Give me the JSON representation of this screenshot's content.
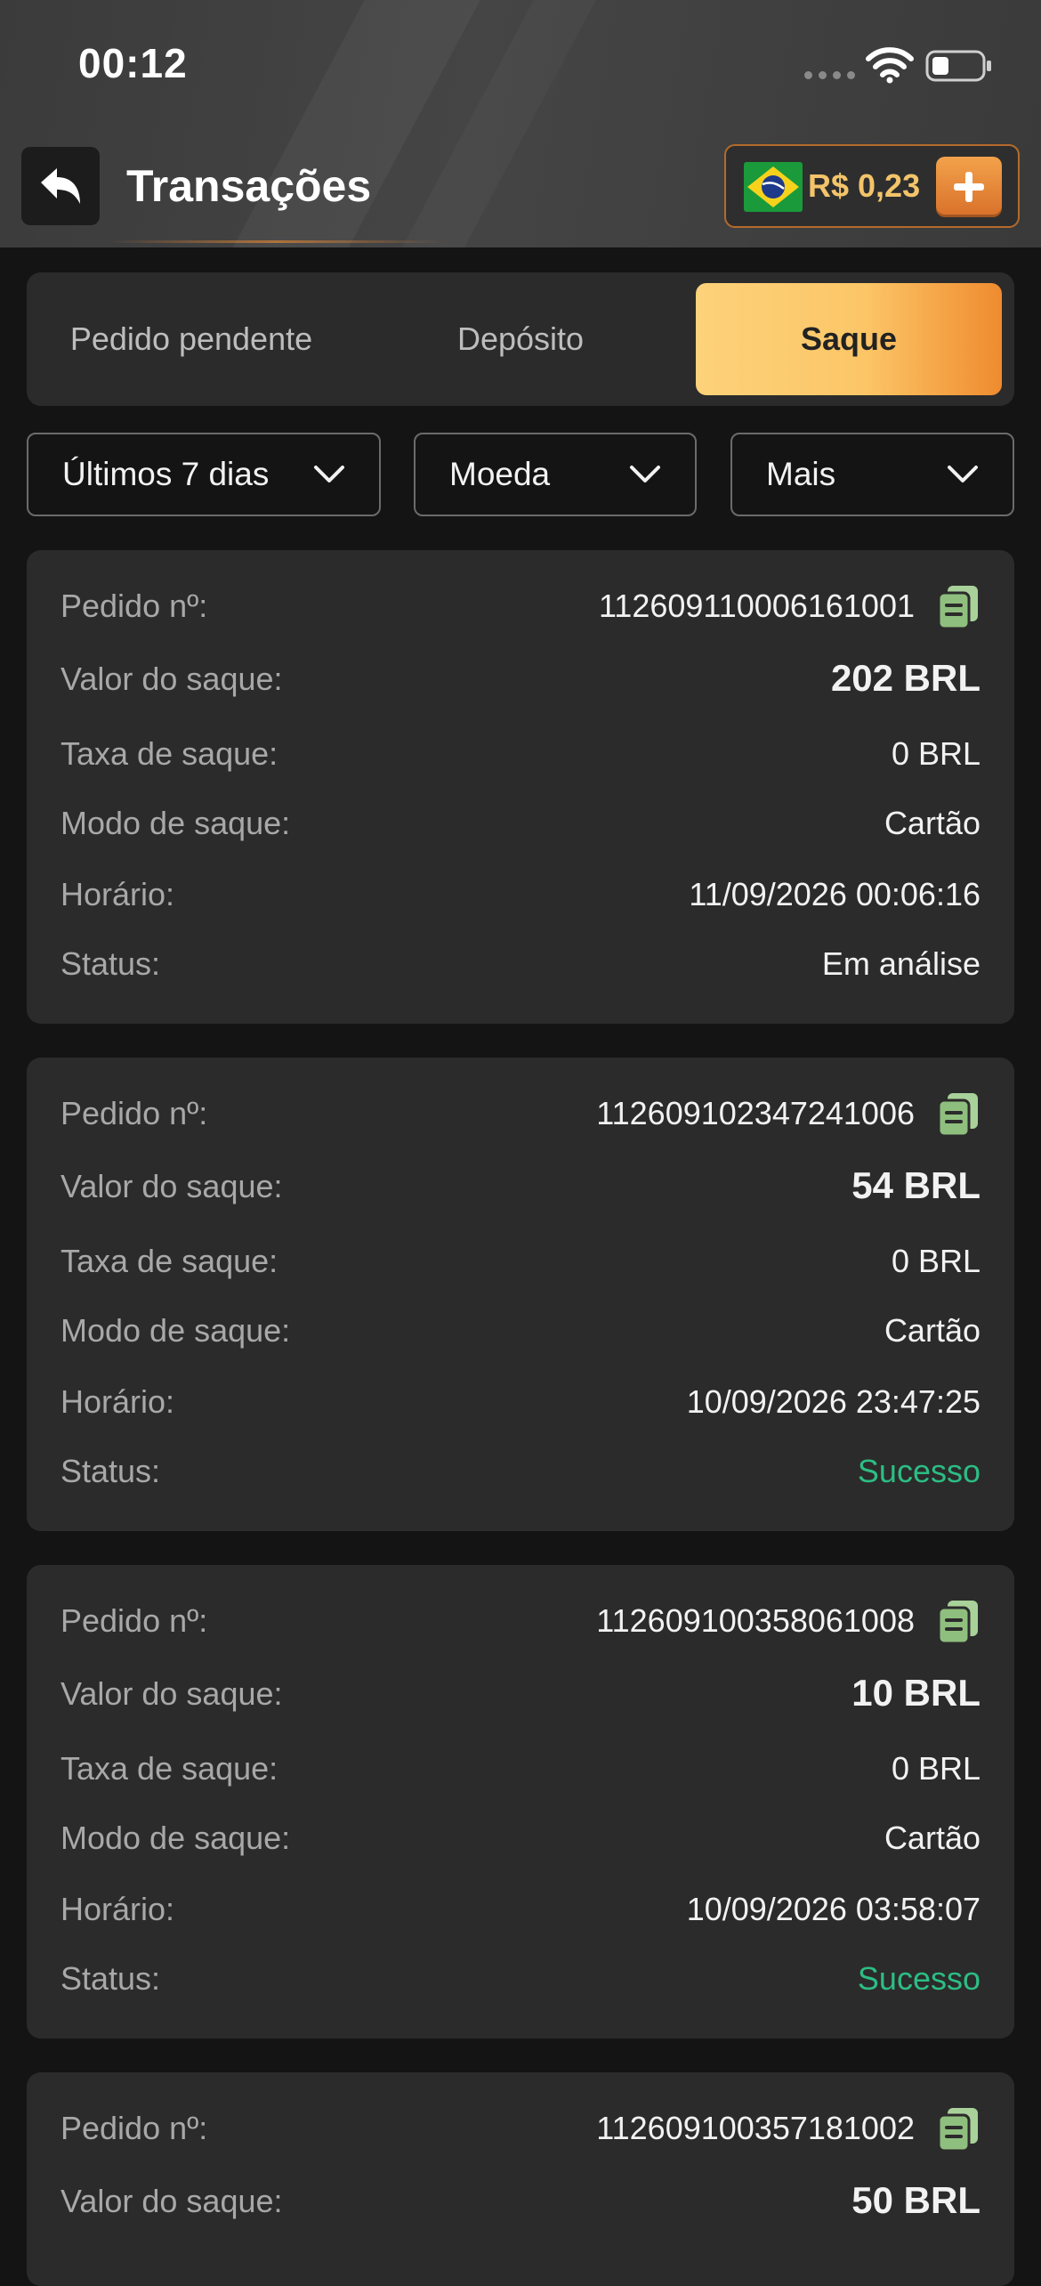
{
  "status_bar": {
    "time": "00:12"
  },
  "header": {
    "title": "Transações",
    "balance": "R$ 0,23"
  },
  "tabs": [
    {
      "label": "Pedido pendente",
      "active": false
    },
    {
      "label": "Depósito",
      "active": false
    },
    {
      "label": "Saque",
      "active": true
    }
  ],
  "filters": [
    {
      "label": "Últimos 7 dias"
    },
    {
      "label": "Moeda"
    },
    {
      "label": "Mais"
    }
  ],
  "labels": {
    "order": "Pedido nº:",
    "amount": "Valor do saque:",
    "fee": "Taxa de saque:",
    "mode": "Modo de saque:",
    "time": "Horário:",
    "status": "Status:"
  },
  "transactions": [
    {
      "order": "112609110006161001",
      "amount": "202 BRL",
      "fee": "0 BRL",
      "mode": "Cartão",
      "time": "11/09/2026 00:06:16",
      "status": "Em análise"
    },
    {
      "order": "112609102347241006",
      "amount": "54 BRL",
      "fee": "0 BRL",
      "mode": "Cartão",
      "time": "10/09/2026 23:47:25",
      "status": "Sucesso"
    },
    {
      "order": "112609100358061008",
      "amount": "10 BRL",
      "fee": "0 BRL",
      "mode": "Cartão",
      "time": "10/09/2026 03:58:07",
      "status": "Sucesso"
    },
    {
      "order": "112609100357181002",
      "amount": "50 BRL"
    }
  ],
  "colors": {
    "accent": "#f3a24b",
    "success": "#2dbd84",
    "balance": "#f3c46a"
  },
  "icons": [
    "back-arrow-icon",
    "brazil-flag-icon",
    "plus-icon",
    "chevron-down-icon",
    "copy-icon",
    "wifi-icon",
    "battery-icon"
  ]
}
